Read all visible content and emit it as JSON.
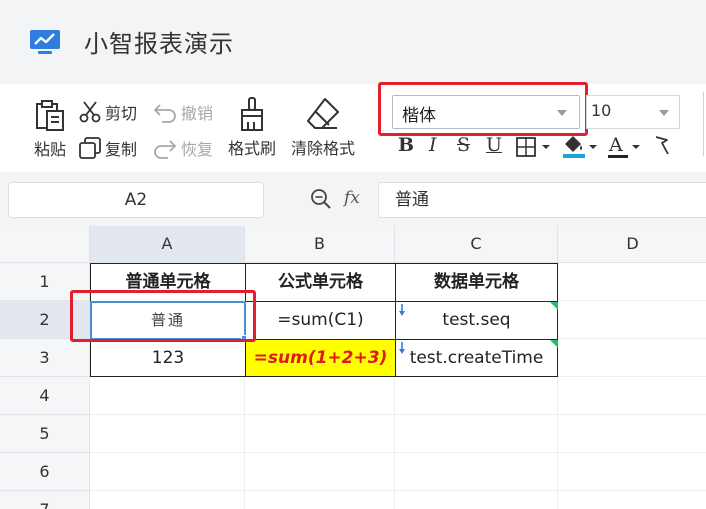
{
  "app": {
    "title": "小智报表演示",
    "logo_icon": "chart-monitor-icon"
  },
  "toolbar": {
    "paste_label": "粘贴",
    "cut_label": "剪切",
    "copy_label": "复制",
    "undo_label": "撤销",
    "redo_label": "恢复",
    "format_painter_label": "格式刷",
    "clear_format_label": "清除格式",
    "font_family": "楷体",
    "font_size": "10",
    "bold_glyph": "B",
    "italic_glyph": "I",
    "strike_glyph": "S",
    "underline_glyph": "U",
    "font_color_glyph": "A"
  },
  "formula_bar": {
    "cell_ref": "A2",
    "fx_label": "fx",
    "content": "普通"
  },
  "sheet": {
    "columns": [
      "A",
      "B",
      "C",
      "D"
    ],
    "rows": [
      "1",
      "2",
      "3",
      "4",
      "5",
      "6",
      "7"
    ],
    "cells": {
      "A1": "普通单元格",
      "B1": "公式单元格",
      "C1": "数据单元格",
      "A2": "普通",
      "B2": "=sum(C1)",
      "C2": "test.seq",
      "A3": "123",
      "B3": "=sum(1+2+3)",
      "C3": "test.createTime"
    },
    "selected_cell": "A2"
  },
  "colors": {
    "highlight_red": "#e0202a",
    "selection_blue": "#4a8fd6",
    "formula_bg": "#ffff00",
    "formula_text": "#e01a1a",
    "data_marker_green": "#1fc26a"
  }
}
